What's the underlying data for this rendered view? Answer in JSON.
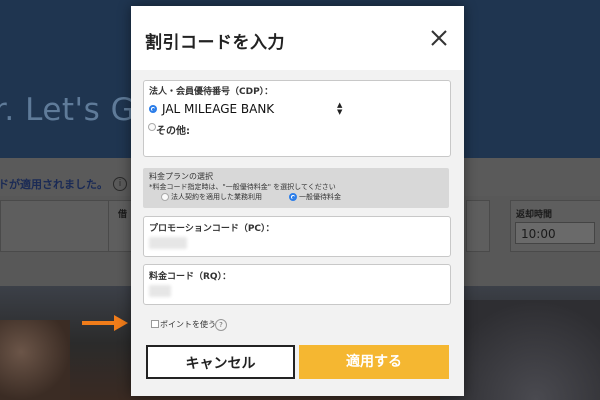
{
  "background": {
    "hero_text": "r. Let's G",
    "notice_text": "ドが適用されました。",
    "notice_icon": "i",
    "field_label_2": "借",
    "field_label_return": "返却時間",
    "return_time": "10:00"
  },
  "modal": {
    "title": "割引コードを入力",
    "close_icon": "close-icon",
    "corporate": {
      "label": "法人・会員優待番号（CDP）：",
      "selected_option": "JAL MILEAGE BANK",
      "other_label": "その他:"
    },
    "rate_plan": {
      "title": "料金プランの選択",
      "note": "*料金コード指定時は、\"一般優待料金\" を選択してください",
      "option_corporate": "法人契約を適用した業務利用",
      "option_general": "一般優待料金",
      "selected": "一般優待料金"
    },
    "promo": {
      "label": "プロモーションコード（PC）："
    },
    "rate_code": {
      "label": "料金コード（RQ）："
    },
    "points": {
      "label": "ポイントを使う",
      "help_icon": "?"
    },
    "buttons": {
      "cancel": "キャンセル",
      "apply": "適用する"
    }
  },
  "colors": {
    "accent_apply": "#f5b731",
    "radio_selected": "#2b7de9",
    "annotation_arrow": "#f07c1a"
  }
}
